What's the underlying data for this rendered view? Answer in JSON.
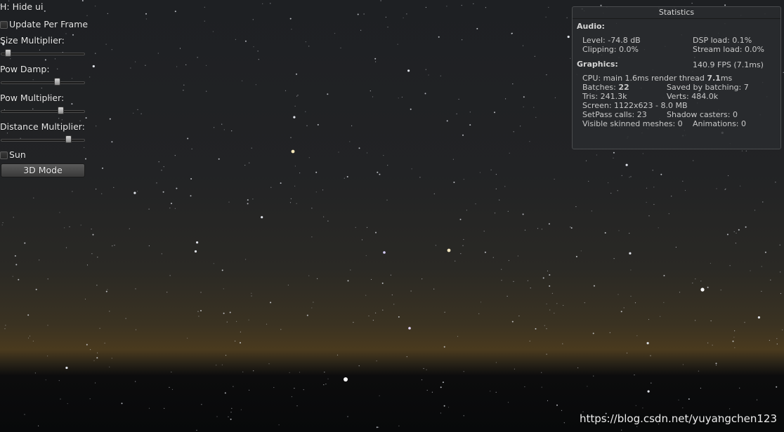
{
  "controls": {
    "hide_hint": "H: Hide ui",
    "update_per_frame_label": "Update Per Frame",
    "update_per_frame_checked": false,
    "size_multiplier_label": "Size Multiplier:",
    "size_multiplier_value": 0.08,
    "pow_damp_label": "Pow Damp:",
    "pow_damp_value": 0.67,
    "pow_multiplier_label": "Pow Multiplier:",
    "pow_multiplier_value": 0.71,
    "distance_multiplier_label": "Distance Multiplier:",
    "distance_multiplier_value": 0.8,
    "sun_label": "Sun",
    "sun_checked": false,
    "mode_button_label": "3D Mode"
  },
  "statistics": {
    "title": "Statistics",
    "audio_heading": "Audio:",
    "level": "Level: -74.8 dB",
    "dsp_load": "DSP load: 0.1%",
    "clipping": "Clipping: 0.0%",
    "stream_load": "Stream load: 0.0%",
    "graphics_heading": "Graphics:",
    "fps": "140.9 FPS (7.1ms)",
    "cpu_prefix": "CPU: main 1.6ms  render thread ",
    "cpu_render_value": "7.1",
    "cpu_suffix": "ms",
    "batches_prefix": "Batches: ",
    "batches_value": "22",
    "saved_by_batching": "Saved by batching: 7",
    "tris": "Tris: 241.3k",
    "verts": "Verts: 484.0k",
    "screen": "Screen: 1122x623 - 8.0 MB",
    "setpass": "SetPass calls: 23",
    "shadow_casters": "Shadow casters: 0",
    "visible_skinned": "Visible skinned meshes: 0",
    "animations": "Animations: 0"
  },
  "watermark": "https://blog.csdn.net/yuyangchen123",
  "colors": {
    "sky_top": "#1e2023",
    "horizon_glow": "#4a3a1e",
    "ground": "#08090a",
    "panel_bg": "#2a2c2e"
  }
}
